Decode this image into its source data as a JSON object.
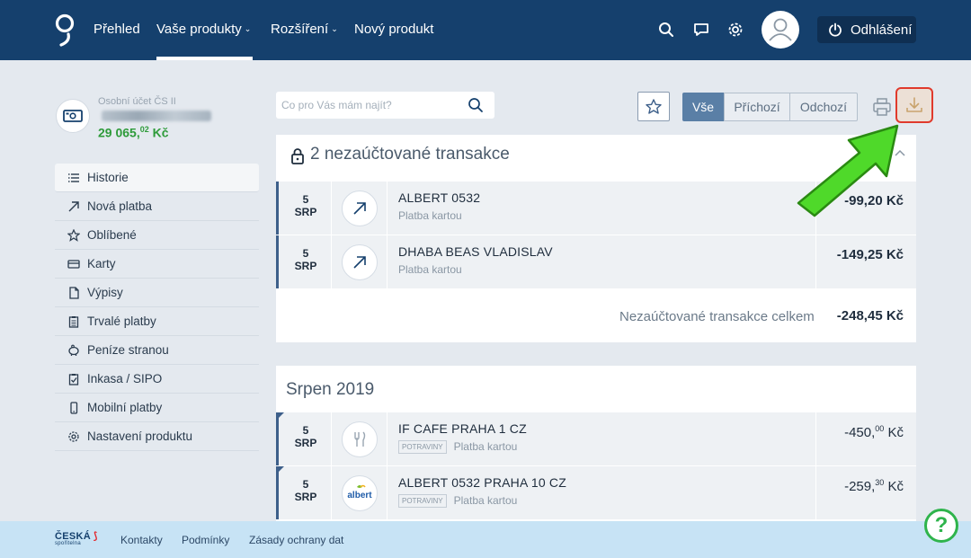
{
  "topnav": {
    "items": [
      "Přehled",
      "Vaše produkty",
      "Rozšíření",
      "Nový produkt"
    ],
    "logout": "Odhlášení"
  },
  "account": {
    "name": "Osobní účet ČS II",
    "balance_main": "29 065,",
    "balance_dec": "02",
    "currency": "Kč"
  },
  "sidebar": {
    "items": [
      {
        "label": "Historie",
        "icon": "list-icon"
      },
      {
        "label": "Nová platba",
        "icon": "arrow-up-right-icon"
      },
      {
        "label": "Oblíbené",
        "icon": "star-icon"
      },
      {
        "label": "Karty",
        "icon": "card-icon"
      },
      {
        "label": "Výpisy",
        "icon": "document-icon"
      },
      {
        "label": "Trvalé platby",
        "icon": "clipboard-icon"
      },
      {
        "label": "Peníze stranou",
        "icon": "piggy-bank-icon"
      },
      {
        "label": "Inkasa / SIPO",
        "icon": "clipboard-check-icon"
      },
      {
        "label": "Mobilní platby",
        "icon": "mobile-icon"
      },
      {
        "label": "Nastavení produktu",
        "icon": "gear-icon"
      }
    ]
  },
  "search": {
    "placeholder": "Co pro Vás mám najít?"
  },
  "filters": {
    "all": "Vše",
    "incoming": "Příchozí",
    "outgoing": "Odchozí"
  },
  "pending": {
    "title": "2 nezaúčtované transakce",
    "rows": [
      {
        "day": "5",
        "month": "SRP",
        "name": "ALBERT 0532",
        "sub": "Platba kartou",
        "amount": "-99,20 Kč"
      },
      {
        "day": "5",
        "month": "SRP",
        "name": "DHABA BEAS VLADISLAV",
        "sub": "Platba kartou",
        "amount": "-149,25 Kč"
      }
    ],
    "total_label": "Nezaúčtované transakce celkem",
    "total_amount": "-248,45 Kč"
  },
  "month": {
    "title": "Srpen 2019",
    "rows": [
      {
        "day": "5",
        "month": "SRP",
        "name": "IF CAFE PRAHA 1 CZ",
        "tag": "POTRAVINY",
        "sub": "Platba kartou",
        "amount_int": "-450,",
        "amount_dec": "00",
        "currency": "Kč"
      },
      {
        "day": "5",
        "month": "SRP",
        "name": "ALBERT 0532 PRAHA 10 CZ",
        "tag": "POTRAVINY",
        "sub": "Platba kartou",
        "amount_int": "-259,",
        "amount_dec": "30",
        "currency": "Kč",
        "logo": "albert"
      }
    ]
  },
  "footer": {
    "brand": "ČESKÁ",
    "brand_small": "spořitelna",
    "links": [
      "Kontakty",
      "Podmínky",
      "Zásady ochrany dat"
    ]
  },
  "colors": {
    "header": "#15406d",
    "accent_green": "#2fb44c",
    "highlight_red": "#e03a2c"
  }
}
